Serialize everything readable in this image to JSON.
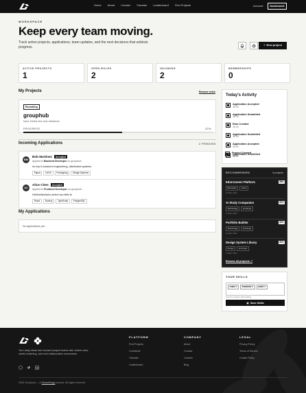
{
  "nav": {
    "links": [
      "Home",
      "About",
      "Contact",
      "Tutorials",
      "Leaderboard",
      "Find Projects"
    ],
    "account": "Account",
    "dashboard": "Dashboard"
  },
  "hero": {
    "eyebrow": "WORKSPACE",
    "title": "Keep every team moving.",
    "subtitle": "Track active projects, applications, team updates, and the next decisions that unblock progress.",
    "new_project": "New project"
  },
  "stats": [
    {
      "label": "ACTIVE PROJECTS",
      "value": "1"
    },
    {
      "label": "OPEN ROLES",
      "value": "2"
    },
    {
      "label": "INCOMING",
      "value": "2"
    },
    {
      "label": "MEMBERSHIPS",
      "value": "0"
    }
  ],
  "my_projects": {
    "title": "My Projects",
    "browse": "Browse roles",
    "project": {
      "status": "Recruiting",
      "name": "grouphub",
      "next": "Next: Define the next milestone",
      "progress_label": "PROGRESS",
      "progress_text": "52%",
      "progress": 0.52
    }
  },
  "incoming": {
    "title": "Incoming Applications",
    "count": "2 PENDING",
    "apps": [
      {
        "initials": "BM",
        "name": "Bob Martinez",
        "badge": "Accepted",
        "applied_prefix": "Applied to",
        "role": "Backend Developer",
        "project_suffix": "on grouphub",
        "note": "im exp in backend engineering, distributed systems",
        "skills": [
          "Figma",
          "UI/UX",
          "Prototyping",
          "Design Systems"
        ]
      },
      {
        "initials": "AC",
        "name": "Alice Chen",
        "badge": "Accepted",
        "applied_prefix": "Applied to",
        "role": "Frontend Developer",
        "project_suffix": "on grouphub",
        "note": "f,fhiihnlilsiohicho,ichioh wa,hfirfx fe",
        "skills": [
          "React",
          "Node.js",
          "TypeScript",
          "PostgreSQL"
        ]
      }
    ]
  },
  "my_applications": {
    "title": "My Applications",
    "empty": "No applications yet."
  },
  "activity": {
    "title": "Today's Activity",
    "items": [
      {
        "text": "Application Accepted",
        "date": "Jul 18"
      },
      {
        "text": "Application Submitted",
        "date": "Jul 18"
      },
      {
        "text": "Role Created",
        "date": "Jul 18"
      },
      {
        "text": "Application Submitted",
        "date": "Jul 18"
      },
      {
        "text": "Application Accepted",
        "date": "Jul 18"
      },
      {
        "text": "Application Submitted",
        "date": "Jul 18"
      },
      {
        "text": "Project Created",
        "date": "Jul 18"
      }
    ]
  },
  "recommended": {
    "title": "RECOMMENDED",
    "count": "6 projects",
    "items": [
      {
        "name": "EduConnect Platform",
        "pct": "38%",
        "tags": [
          "Education",
          "active"
        ],
        "meta": "2 open roles"
      },
      {
        "name": "AI Study Companion",
        "pct": "31%",
        "tags": [
          "Technology",
          "prototype"
        ],
        "meta": "2 open roles"
      },
      {
        "name": "Portfolio Builder",
        "pct": "31%",
        "tags": [
          "Technology",
          "prototype"
        ],
        "meta": "2 open roles"
      },
      {
        "name": "Design System Library",
        "pct": "31%",
        "tags": [
          "Design",
          "prototype"
        ],
        "meta": "2 open roles"
      }
    ],
    "browse": "Browse all projects"
  },
  "skills": {
    "title": "YOUR SKILLS",
    "chips": [
      "react",
      "frontend",
      "node"
    ],
    "hint": "Used for project matchmaking",
    "save": "Save Skills"
  },
  "footer": {
    "tagline": "Turn early ideas into focused project teams with visible roles, useful matching, and real collaboration momentum.",
    "columns": [
      {
        "title": "PLATFORM",
        "items": [
          "Find Projects",
          "Contribute",
          "Tutorials",
          "Leaderboard"
        ]
      },
      {
        "title": "COMPANY",
        "items": [
          "About",
          "Contact",
          "Careers",
          "Blog"
        ]
      },
      {
        "title": "LEGAL",
        "items": [
          "Privacy Policy",
          "Terms of Service",
          "Cookie Policy"
        ]
      }
    ],
    "copy_prefix": "2026 Grouphub — A",
    "copy_link": "CleverForge",
    "copy_suffix": "product. All rights reserved."
  },
  "colors": {
    "dark": "#111111",
    "panel": "#1c1c1c",
    "bg": "#f4f4f1"
  }
}
